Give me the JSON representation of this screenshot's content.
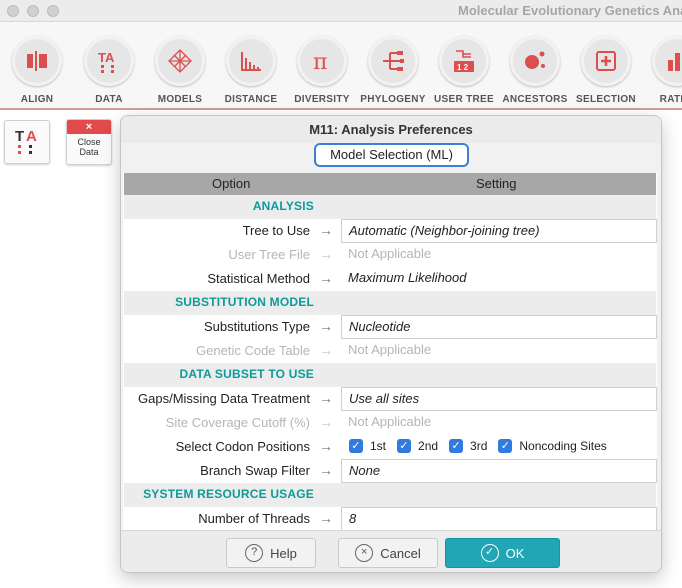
{
  "window": {
    "title": "Molecular Evolutionary Genetics Analysis"
  },
  "toolbar": {
    "items": [
      {
        "label": "ALIGN",
        "icon": "align-icon"
      },
      {
        "label": "DATA",
        "icon": "data-icon"
      },
      {
        "label": "MODELS",
        "icon": "models-icon"
      },
      {
        "label": "DISTANCE",
        "icon": "distance-icon"
      },
      {
        "label": "DIVERSITY",
        "icon": "diversity-icon"
      },
      {
        "label": "PHYLOGENY",
        "icon": "phylogeny-icon"
      },
      {
        "label": "USER TREE",
        "icon": "user-tree-icon"
      },
      {
        "label": "ANCESTORS",
        "icon": "ancestors-icon"
      },
      {
        "label": "SELECTION",
        "icon": "selection-icon"
      },
      {
        "label": "RATES",
        "icon": "rates-icon"
      }
    ]
  },
  "tiles": {
    "ta_glyph": "TA",
    "close_x": "×",
    "close_line1": "Close",
    "close_line2": "Data"
  },
  "dialog": {
    "title": "M11: Analysis Preferences",
    "tab": "Model Selection (ML)",
    "col_option": "Option",
    "col_setting": "Setting",
    "arrow": "→",
    "sections": {
      "analysis": "ANALYSIS",
      "substitution": "SUBSTITUTION MODEL",
      "subset": "DATA SUBSET TO USE",
      "resources": "SYSTEM RESOURCE USAGE"
    },
    "rows": {
      "tree_to_use": {
        "label": "Tree to Use",
        "value": "Automatic (Neighbor-joining tree)"
      },
      "user_tree_file": {
        "label": "User Tree File",
        "value": "Not Applicable"
      },
      "stat_method": {
        "label": "Statistical Method",
        "value": "Maximum Likelihood"
      },
      "subst_type": {
        "label": "Substitutions Type",
        "value": "Nucleotide"
      },
      "genetic_code": {
        "label": "Genetic Code Table",
        "value": "Not Applicable"
      },
      "gaps": {
        "label": "Gaps/Missing Data Treatment",
        "value": "Use all sites"
      },
      "site_coverage": {
        "label": "Site Coverage Cutoff (%)",
        "value": "Not Applicable"
      },
      "codon_positions": {
        "label": "Select Codon Positions",
        "options": [
          {
            "label": "1st",
            "checked": true
          },
          {
            "label": "2nd",
            "checked": true
          },
          {
            "label": "3rd",
            "checked": true
          },
          {
            "label": "Noncoding Sites",
            "checked": true
          }
        ]
      },
      "branch_swap": {
        "label": "Branch Swap Filter",
        "value": "None"
      },
      "threads": {
        "label": "Number of Threads",
        "value": "8"
      }
    },
    "buttons": {
      "help": "Help",
      "cancel": "Cancel",
      "ok": "OK",
      "help_icon": "?",
      "cancel_icon": "×",
      "ok_icon": "✓"
    }
  },
  "colors": {
    "accent": "#21a6b5",
    "section_heading": "#0b9b9b",
    "toolbar_icon": "#dc4f4f",
    "checkbox": "#2f7be0"
  }
}
